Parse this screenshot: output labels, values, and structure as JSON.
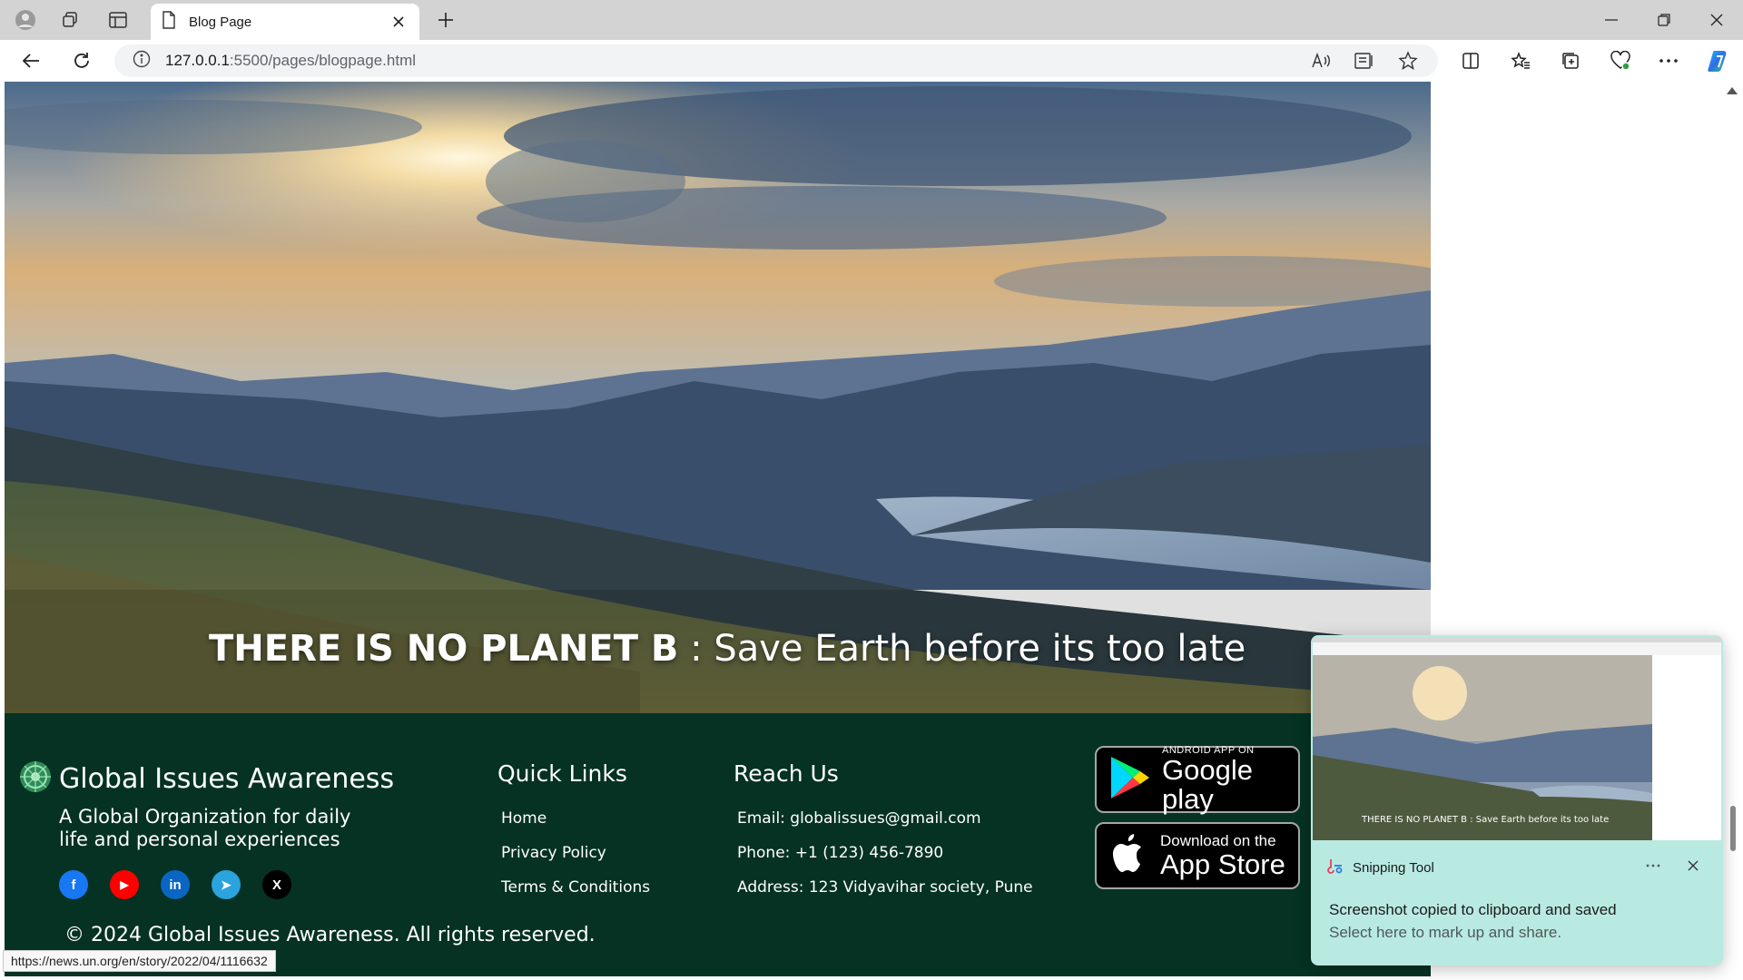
{
  "browser": {
    "tab": {
      "title": "Blog Page"
    },
    "address": {
      "host": "127.0.0.1",
      "rest": ":5500/pages/blogpage.html"
    },
    "status_url": "https://news.un.org/en/story/2022/04/1116632"
  },
  "hero": {
    "caption_bold": "THERE IS NO PLANET B",
    "caption_rest": " : Save Earth before its too late"
  },
  "footer": {
    "brand_name": "Global Issues Awareness",
    "tagline": "A Global Organization for daily life and personal experiences",
    "socials": [
      {
        "icon": "facebook-icon",
        "glyph": "f",
        "color": "#1877f2"
      },
      {
        "icon": "youtube-icon",
        "glyph": "▶",
        "color": "#ff0000"
      },
      {
        "icon": "linkedin-icon",
        "glyph": "in",
        "color": "#0a66c2"
      },
      {
        "icon": "telegram-icon",
        "glyph": "➤",
        "color": "#2aa3df"
      },
      {
        "icon": "x-icon",
        "glyph": "X",
        "color": "#000000"
      }
    ],
    "quick_links": {
      "heading": "Quick Links",
      "items": [
        "Home",
        "Privacy Policy",
        "Terms & Conditions"
      ]
    },
    "reach_us": {
      "heading": "Reach Us",
      "items": [
        "Email: globalissues@gmail.com",
        "Phone: +1 (123) 456-7890",
        "Address: 123 Vidyavihar society, Pune"
      ]
    },
    "google_play": {
      "small": "ANDROID APP ON",
      "big": "Google play"
    },
    "app_store": {
      "small": "Download on the",
      "big": "App Store"
    },
    "copyright": "© 2024 Global Issues Awareness. All rights reserved."
  },
  "toast": {
    "app": "Snipping Tool",
    "message": "Screenshot copied to clipboard and saved",
    "sub": "Select here to mark up and share.",
    "thumb_caption": "THERE IS NO PLANET B : Save Earth before its too late"
  },
  "colors": {
    "footer_bg": "#053223",
    "toast_bg": "#b9eae2",
    "tab_strip": "#d3d3d3"
  }
}
